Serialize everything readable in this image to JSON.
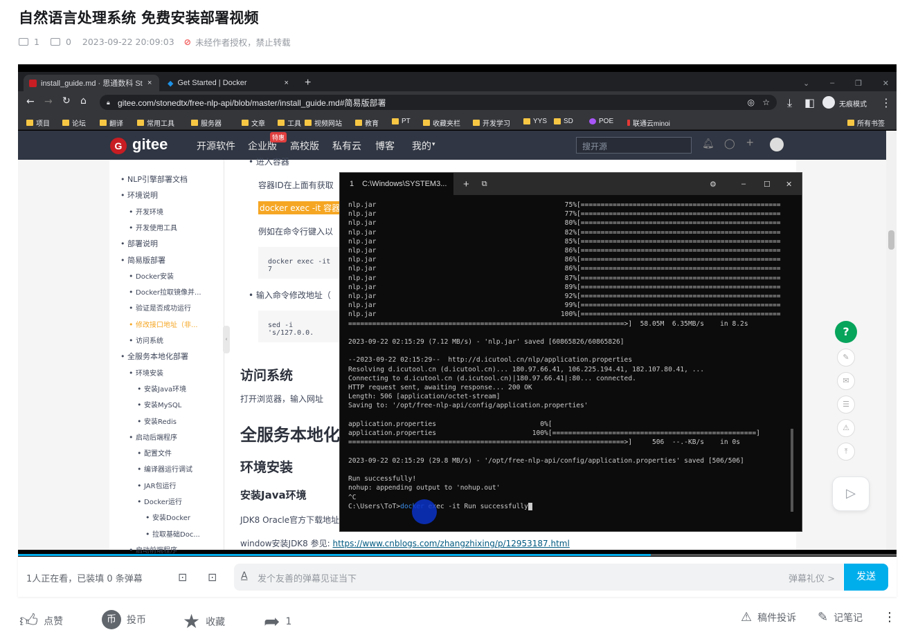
{
  "page": {
    "title": "自然语言处理系统 免费安装部署视频",
    "views": "1",
    "danmaku_count": "0",
    "datetime": "2023-09-22 20:09:03",
    "notice": "未经作者授权，禁止转载"
  },
  "browser": {
    "tab1": "install_guide.md · 思通数科 St",
    "tab2": "Get Started | Docker",
    "url": "gitee.com/stonedtx/free-nlp-api/blob/master/install_guide.md#简易版部署",
    "incognito": "无痕模式",
    "bookmarks": [
      "项目",
      "论坛",
      "翻译",
      "常用工具",
      "服务器",
      "文章",
      "工具",
      "视频网站",
      "教育",
      "PT",
      "收藏夹栏",
      "开发学习",
      "YYS",
      "SD",
      "POE",
      "联通云minoi"
    ],
    "all_bookmarks": "所有书签"
  },
  "gitee": {
    "logo": "gitee",
    "nav": [
      "开源软件",
      "企业版",
      "高校版",
      "私有云",
      "博客",
      "我的"
    ],
    "badge": "特惠",
    "search_placeholder": "搜开源"
  },
  "toc": [
    "NLP引擎部署文档",
    "环境说明",
    "开发环境",
    "开发使用工具",
    "部署说明",
    "简易版部署",
    "Docker安装",
    "Docker拉取镜像并...",
    "验证是否成功运行",
    "修改接口地址（非...",
    "访问系统",
    "全服务本地化部署",
    "环境安装",
    "安装Java环境",
    "安装MySQL",
    "安装Redis",
    "启动后端程序",
    "配置文件",
    "编译器运行调试",
    "JAR包运行",
    "Docker运行",
    "安装Docker",
    "拉取基础Doc...",
    "启动前端程序"
  ],
  "doc": {
    "enter_container": "进入容器",
    "container_id": "容器ID在上面有获取",
    "docker_exec": "docker exec -it 容器",
    "example": "例如在命令行键入以",
    "code1": "docker exec -it 7",
    "modify_addr": "输入命令修改地址（",
    "code2": "sed -i 's/127.0.0.",
    "h_access": "访问系统",
    "access_text": "打开浏览器，输入网址",
    "h_full": "全服务本地化",
    "h_env": "环境安装",
    "h_java": "安装Java环境",
    "jdk": "JDK8 Oracle官方下载地址",
    "window_jdk": "window安装JDK8 参见:",
    "jdk_link": "https://www.cnblogs.com/zhangzhixing/p/12953187.html"
  },
  "terminal": {
    "tab": "C:\\Windows\\SYSTEM3...",
    "tab_index": "1",
    "progress": [
      [
        "nlp.jar",
        "75%"
      ],
      [
        "nlp.jar",
        "77%"
      ],
      [
        "nlp.jar",
        "80%"
      ],
      [
        "nlp.jar",
        "82%"
      ],
      [
        "nlp.jar",
        "85%"
      ],
      [
        "nlp.jar",
        "86%"
      ],
      [
        "nlp.jar",
        "86%"
      ],
      [
        "nlp.jar",
        "86%"
      ],
      [
        "nlp.jar",
        "87%"
      ],
      [
        "nlp.jar",
        "89%"
      ],
      [
        "nlp.jar",
        "92%"
      ],
      [
        "nlp.jar",
        "99%"
      ],
      [
        "nlp.jar",
        "100%"
      ]
    ],
    "line_summary1": "=====================================================================>]  58.05M  6.35MB/s    in 8.2s",
    "line_saved1": "2023-09-22 02:15:29 (7.12 MB/s) - 'nlp.jar' saved [60865826/60865826]",
    "line_fetch": "--2023-09-22 02:15:29--  http://d.icutool.cn/nlp/application.properties",
    "line_resolve": "Resolving d.icutool.cn (d.icutool.cn)... 180.97.66.41, 106.225.194.41, 182.107.80.41, ...",
    "line_connect": "Connecting to d.icutool.cn (d.icutool.cn)|180.97.66.41|:80... connected.",
    "line_http": "HTTP request sent, awaiting response... 200 OK",
    "line_length": "Length: 506 [application/octet-stream]",
    "line_saving": "Saving to: '/opt/free-nlp-api/config/application.properties'",
    "line_app0": "application.properties                          0%[",
    "line_app100": "application.properties                        100%[===================================================]",
    "line_summary2": "=====================================================================>]     506  --.-KB/s    in 0s",
    "line_saved2": "2023-09-22 02:15:29 (29.8 MB/s) - '/opt/free-nlp-api/config/application.properties' saved [506/506]",
    "line_run": "Run successfully!",
    "line_nohup": "nohup: appending output to 'nohup.out'",
    "line_ctrl": "^C",
    "prompt": "C:\\Users\\ToT>",
    "cmd_docker": "docker",
    "cmd_rest": " exec -it Run successfully"
  },
  "bottom": {
    "watching": "1人正在看，已装填 0 条弹幕",
    "danmaku_placeholder": "发个友善的弹幕见证当下",
    "etiquette": "弹幕礼仪 >",
    "send": "发送"
  },
  "actions": {
    "like": "点赞",
    "coin": "投币",
    "fav": "收藏",
    "share": "1",
    "report": "稿件投诉",
    "note": "记笔记"
  },
  "colors": {
    "accent": "#00aeec",
    "warn": "#f25d5d",
    "gitee_red": "#c71d23",
    "help_green": "#07a45c"
  }
}
